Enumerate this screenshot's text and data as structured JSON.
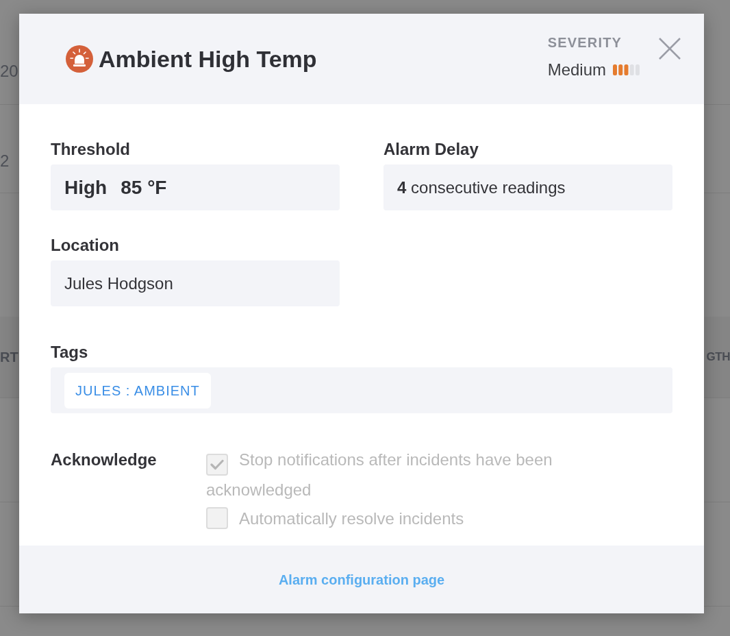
{
  "background_page": {
    "items": [
      "20",
      "2"
    ],
    "table_header": [
      "RT",
      "GTH"
    ]
  },
  "dialog": {
    "header": {
      "title": "Ambient High Temp",
      "severity": {
        "label": "SEVERITY",
        "value": "Medium",
        "level": 0.6
      }
    },
    "fields": [
      {
        "label": "Threshold",
        "kind": "threshold",
        "level_name": "High",
        "value": "85 °F"
      },
      {
        "label": "Alarm Delay",
        "kind": "text",
        "value": "**4** consecutive readings"
      },
      {
        "label": "Location",
        "kind": "text",
        "value": "Jules Hodgson"
      }
    ],
    "tags": {
      "label": "Tags",
      "items": [
        "JULES : AMBIENT"
      ]
    },
    "acknowledge": {
      "label": "Acknowledge",
      "options": [
        {
          "label": "Stop notifications after incidents have been acknowledged",
          "checked": true,
          "disabled": true
        },
        {
          "label": "Automatically resolve incidents",
          "checked": false,
          "disabled": true
        }
      ]
    },
    "footer": {
      "link": "Alarm configuration page"
    }
  }
}
